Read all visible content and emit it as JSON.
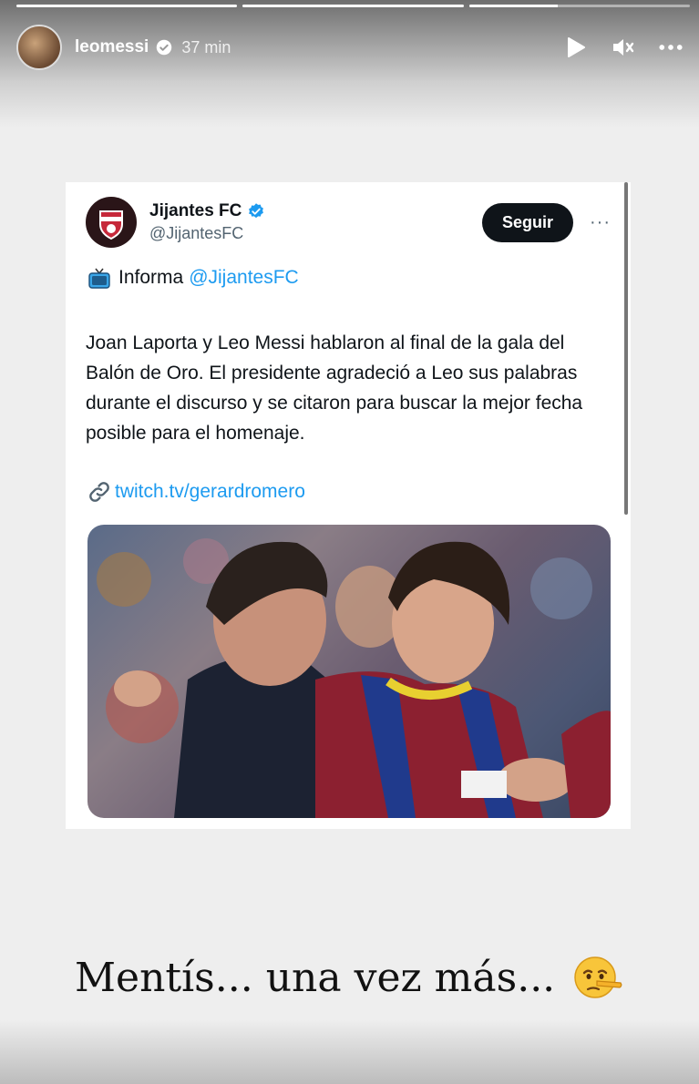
{
  "story": {
    "progress": [
      1.0,
      1.0,
      0.4
    ],
    "username": "leomessi",
    "time": "37 min",
    "controls": {
      "play_icon": "play-icon",
      "mute_icon": "speaker-muted-icon",
      "more_icon": "more-horizontal-icon"
    },
    "caption": "Mentís... una vez más...",
    "caption_emoji": "lying-face-emoji"
  },
  "tweet": {
    "author_name": "Jijantes FC",
    "handle": "@JijantesFC",
    "follow_label": "Seguir",
    "more_label": "···",
    "informa_label": "Informa",
    "informa_mention": "@JijantesFC",
    "body": "Joan Laporta y Leo Messi hablaron al final de la gala del Balón de Oro. El presidente agradeció a Leo sus palabras  durante el discurso y se citaron para buscar la mejor fecha posible para el homenaje.",
    "link": "twitch.tv/gerardromero",
    "photo_alt": "photo"
  },
  "colors": {
    "accent_blue": "#1d9bf0",
    "follow_bg": "#0f1419"
  }
}
